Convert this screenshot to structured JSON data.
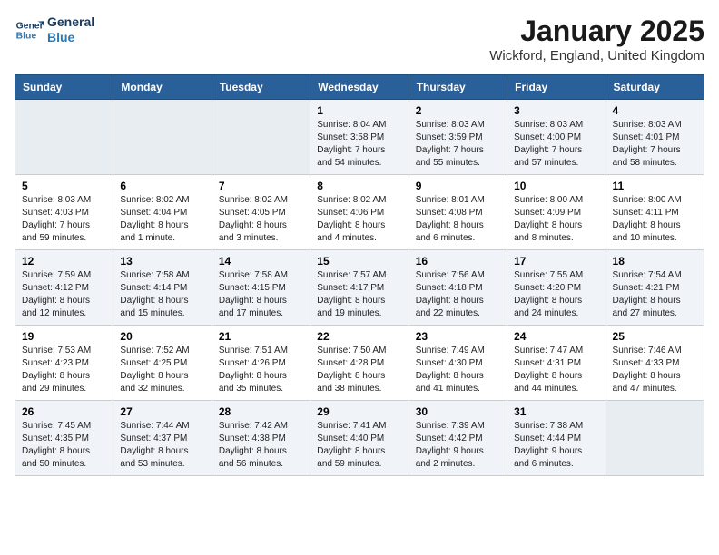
{
  "header": {
    "logo_line1": "General",
    "logo_line2": "Blue",
    "title": "January 2025",
    "location": "Wickford, England, United Kingdom"
  },
  "weekdays": [
    "Sunday",
    "Monday",
    "Tuesday",
    "Wednesday",
    "Thursday",
    "Friday",
    "Saturday"
  ],
  "weeks": [
    [
      {
        "day": "",
        "info": ""
      },
      {
        "day": "",
        "info": ""
      },
      {
        "day": "",
        "info": ""
      },
      {
        "day": "1",
        "info": "Sunrise: 8:04 AM\nSunset: 3:58 PM\nDaylight: 7 hours\nand 54 minutes."
      },
      {
        "day": "2",
        "info": "Sunrise: 8:03 AM\nSunset: 3:59 PM\nDaylight: 7 hours\nand 55 minutes."
      },
      {
        "day": "3",
        "info": "Sunrise: 8:03 AM\nSunset: 4:00 PM\nDaylight: 7 hours\nand 57 minutes."
      },
      {
        "day": "4",
        "info": "Sunrise: 8:03 AM\nSunset: 4:01 PM\nDaylight: 7 hours\nand 58 minutes."
      }
    ],
    [
      {
        "day": "5",
        "info": "Sunrise: 8:03 AM\nSunset: 4:03 PM\nDaylight: 7 hours\nand 59 minutes."
      },
      {
        "day": "6",
        "info": "Sunrise: 8:02 AM\nSunset: 4:04 PM\nDaylight: 8 hours\nand 1 minute."
      },
      {
        "day": "7",
        "info": "Sunrise: 8:02 AM\nSunset: 4:05 PM\nDaylight: 8 hours\nand 3 minutes."
      },
      {
        "day": "8",
        "info": "Sunrise: 8:02 AM\nSunset: 4:06 PM\nDaylight: 8 hours\nand 4 minutes."
      },
      {
        "day": "9",
        "info": "Sunrise: 8:01 AM\nSunset: 4:08 PM\nDaylight: 8 hours\nand 6 minutes."
      },
      {
        "day": "10",
        "info": "Sunrise: 8:00 AM\nSunset: 4:09 PM\nDaylight: 8 hours\nand 8 minutes."
      },
      {
        "day": "11",
        "info": "Sunrise: 8:00 AM\nSunset: 4:11 PM\nDaylight: 8 hours\nand 10 minutes."
      }
    ],
    [
      {
        "day": "12",
        "info": "Sunrise: 7:59 AM\nSunset: 4:12 PM\nDaylight: 8 hours\nand 12 minutes."
      },
      {
        "day": "13",
        "info": "Sunrise: 7:58 AM\nSunset: 4:14 PM\nDaylight: 8 hours\nand 15 minutes."
      },
      {
        "day": "14",
        "info": "Sunrise: 7:58 AM\nSunset: 4:15 PM\nDaylight: 8 hours\nand 17 minutes."
      },
      {
        "day": "15",
        "info": "Sunrise: 7:57 AM\nSunset: 4:17 PM\nDaylight: 8 hours\nand 19 minutes."
      },
      {
        "day": "16",
        "info": "Sunrise: 7:56 AM\nSunset: 4:18 PM\nDaylight: 8 hours\nand 22 minutes."
      },
      {
        "day": "17",
        "info": "Sunrise: 7:55 AM\nSunset: 4:20 PM\nDaylight: 8 hours\nand 24 minutes."
      },
      {
        "day": "18",
        "info": "Sunrise: 7:54 AM\nSunset: 4:21 PM\nDaylight: 8 hours\nand 27 minutes."
      }
    ],
    [
      {
        "day": "19",
        "info": "Sunrise: 7:53 AM\nSunset: 4:23 PM\nDaylight: 8 hours\nand 29 minutes."
      },
      {
        "day": "20",
        "info": "Sunrise: 7:52 AM\nSunset: 4:25 PM\nDaylight: 8 hours\nand 32 minutes."
      },
      {
        "day": "21",
        "info": "Sunrise: 7:51 AM\nSunset: 4:26 PM\nDaylight: 8 hours\nand 35 minutes."
      },
      {
        "day": "22",
        "info": "Sunrise: 7:50 AM\nSunset: 4:28 PM\nDaylight: 8 hours\nand 38 minutes."
      },
      {
        "day": "23",
        "info": "Sunrise: 7:49 AM\nSunset: 4:30 PM\nDaylight: 8 hours\nand 41 minutes."
      },
      {
        "day": "24",
        "info": "Sunrise: 7:47 AM\nSunset: 4:31 PM\nDaylight: 8 hours\nand 44 minutes."
      },
      {
        "day": "25",
        "info": "Sunrise: 7:46 AM\nSunset: 4:33 PM\nDaylight: 8 hours\nand 47 minutes."
      }
    ],
    [
      {
        "day": "26",
        "info": "Sunrise: 7:45 AM\nSunset: 4:35 PM\nDaylight: 8 hours\nand 50 minutes."
      },
      {
        "day": "27",
        "info": "Sunrise: 7:44 AM\nSunset: 4:37 PM\nDaylight: 8 hours\nand 53 minutes."
      },
      {
        "day": "28",
        "info": "Sunrise: 7:42 AM\nSunset: 4:38 PM\nDaylight: 8 hours\nand 56 minutes."
      },
      {
        "day": "29",
        "info": "Sunrise: 7:41 AM\nSunset: 4:40 PM\nDaylight: 8 hours\nand 59 minutes."
      },
      {
        "day": "30",
        "info": "Sunrise: 7:39 AM\nSunset: 4:42 PM\nDaylight: 9 hours\nand 2 minutes."
      },
      {
        "day": "31",
        "info": "Sunrise: 7:38 AM\nSunset: 4:44 PM\nDaylight: 9 hours\nand 6 minutes."
      },
      {
        "day": "",
        "info": ""
      }
    ]
  ]
}
